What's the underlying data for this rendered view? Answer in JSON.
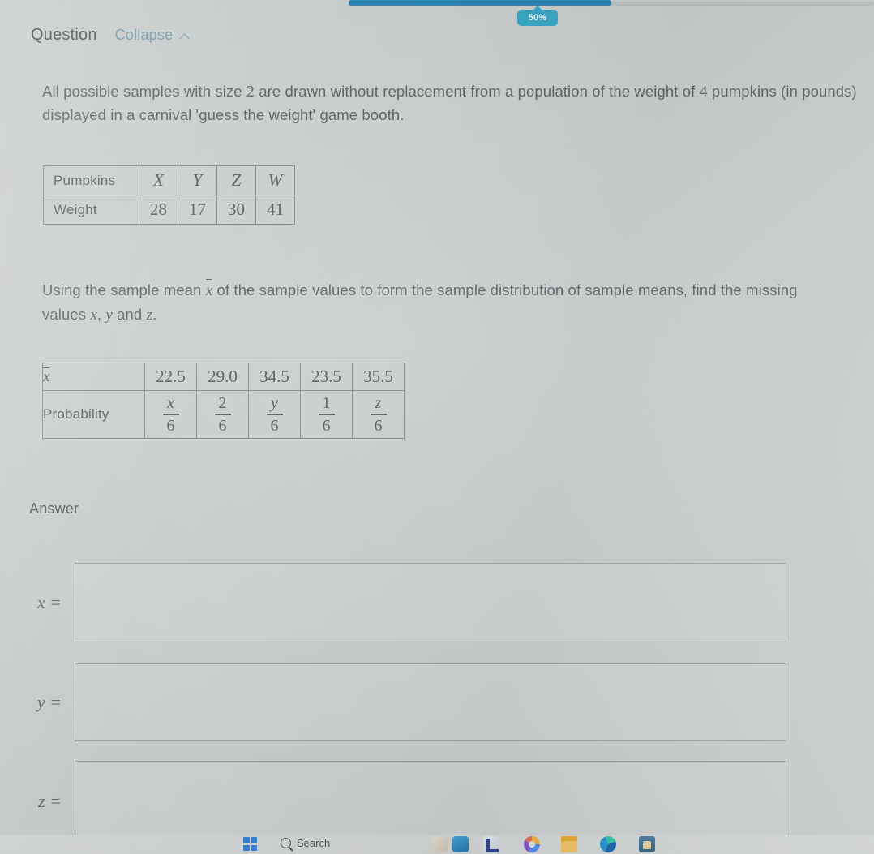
{
  "progress": {
    "percent_label": "50%",
    "percent_value": 50,
    "fill_color": "#1f7fb0",
    "track_color": "#b9bfc0",
    "badge_color": "#2aa3c4"
  },
  "header": {
    "title": "Question",
    "collapse_label": "Collapse",
    "collapse_icon": "chevron-up-icon",
    "link_color": "#6f98ad"
  },
  "question": {
    "statement_1_parts": {
      "a": "All possible samples with size ",
      "sample_size": "2",
      "b": " are drawn without replacement from a population of the weight of ",
      "population_size": "4",
      "c": " pumpkins (in pounds) displayed in a carnival 'guess the weight' game booth."
    },
    "statement_2_parts": {
      "a": "Using the sample mean ",
      "xbar": "x",
      "b": " of the sample values to form the sample distribution of sample means, find the missing values ",
      "v1": "x",
      "sep1": ", ",
      "v2": "y",
      "sep2": " and ",
      "v3": "z",
      "end": "."
    }
  },
  "table_pumpkins": {
    "row_labels": [
      "Pumpkins",
      "Weight"
    ],
    "names": [
      "X",
      "Y",
      "Z",
      "W"
    ],
    "weights": [
      "28",
      "17",
      "30",
      "41"
    ]
  },
  "table_distribution": {
    "row_label_1": "x",
    "row_label_2": "Probability",
    "means": [
      "22.5",
      "29.0",
      "34.5",
      "23.5",
      "35.5"
    ],
    "probabilities": [
      {
        "num": "x",
        "den": "6",
        "italic": true
      },
      {
        "num": "2",
        "den": "6",
        "italic": false
      },
      {
        "num": "y",
        "den": "6",
        "italic": true
      },
      {
        "num": "1",
        "den": "6",
        "italic": false
      },
      {
        "num": "z",
        "den": "6",
        "italic": true
      }
    ]
  },
  "answer": {
    "heading": "Answer",
    "fields": [
      {
        "label": "x =",
        "value": "",
        "placeholder": ""
      },
      {
        "label": "y =",
        "value": "",
        "placeholder": ""
      },
      {
        "label": "z =",
        "value": "",
        "placeholder": ""
      }
    ]
  },
  "taskbar": {
    "start_icon": "windows-start-icon",
    "search_label": "Search",
    "search_icon": "search-icon",
    "apps": [
      "pen-icon",
      "water-bottle-icon",
      "word-icon",
      "chrome-icon",
      "folder-icon",
      "edge-icon",
      "store-icon"
    ]
  }
}
